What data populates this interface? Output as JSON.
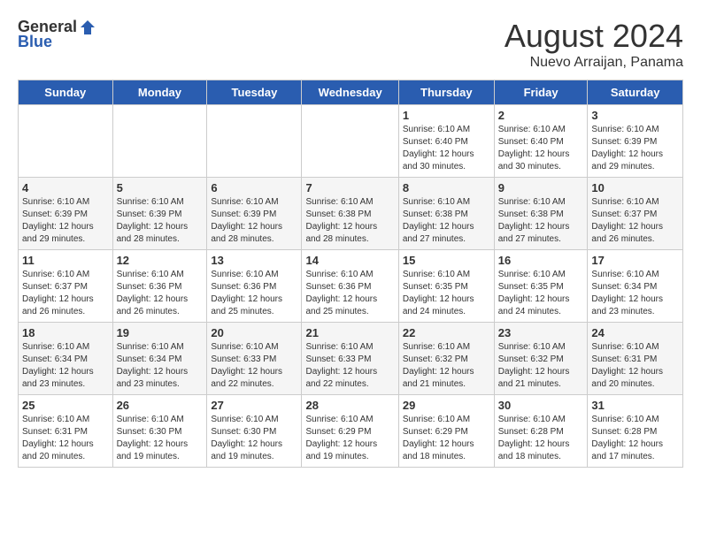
{
  "header": {
    "logo_general": "General",
    "logo_blue": "Blue",
    "title": "August 2024",
    "location": "Nuevo Arraijan, Panama"
  },
  "days_of_week": [
    "Sunday",
    "Monday",
    "Tuesday",
    "Wednesday",
    "Thursday",
    "Friday",
    "Saturday"
  ],
  "weeks": [
    [
      {
        "day": "",
        "info": ""
      },
      {
        "day": "",
        "info": ""
      },
      {
        "day": "",
        "info": ""
      },
      {
        "day": "",
        "info": ""
      },
      {
        "day": "1",
        "info": "Sunrise: 6:10 AM\nSunset: 6:40 PM\nDaylight: 12 hours\nand 30 minutes."
      },
      {
        "day": "2",
        "info": "Sunrise: 6:10 AM\nSunset: 6:40 PM\nDaylight: 12 hours\nand 30 minutes."
      },
      {
        "day": "3",
        "info": "Sunrise: 6:10 AM\nSunset: 6:39 PM\nDaylight: 12 hours\nand 29 minutes."
      }
    ],
    [
      {
        "day": "4",
        "info": "Sunrise: 6:10 AM\nSunset: 6:39 PM\nDaylight: 12 hours\nand 29 minutes."
      },
      {
        "day": "5",
        "info": "Sunrise: 6:10 AM\nSunset: 6:39 PM\nDaylight: 12 hours\nand 28 minutes."
      },
      {
        "day": "6",
        "info": "Sunrise: 6:10 AM\nSunset: 6:39 PM\nDaylight: 12 hours\nand 28 minutes."
      },
      {
        "day": "7",
        "info": "Sunrise: 6:10 AM\nSunset: 6:38 PM\nDaylight: 12 hours\nand 28 minutes."
      },
      {
        "day": "8",
        "info": "Sunrise: 6:10 AM\nSunset: 6:38 PM\nDaylight: 12 hours\nand 27 minutes."
      },
      {
        "day": "9",
        "info": "Sunrise: 6:10 AM\nSunset: 6:38 PM\nDaylight: 12 hours\nand 27 minutes."
      },
      {
        "day": "10",
        "info": "Sunrise: 6:10 AM\nSunset: 6:37 PM\nDaylight: 12 hours\nand 26 minutes."
      }
    ],
    [
      {
        "day": "11",
        "info": "Sunrise: 6:10 AM\nSunset: 6:37 PM\nDaylight: 12 hours\nand 26 minutes."
      },
      {
        "day": "12",
        "info": "Sunrise: 6:10 AM\nSunset: 6:36 PM\nDaylight: 12 hours\nand 26 minutes."
      },
      {
        "day": "13",
        "info": "Sunrise: 6:10 AM\nSunset: 6:36 PM\nDaylight: 12 hours\nand 25 minutes."
      },
      {
        "day": "14",
        "info": "Sunrise: 6:10 AM\nSunset: 6:36 PM\nDaylight: 12 hours\nand 25 minutes."
      },
      {
        "day": "15",
        "info": "Sunrise: 6:10 AM\nSunset: 6:35 PM\nDaylight: 12 hours\nand 24 minutes."
      },
      {
        "day": "16",
        "info": "Sunrise: 6:10 AM\nSunset: 6:35 PM\nDaylight: 12 hours\nand 24 minutes."
      },
      {
        "day": "17",
        "info": "Sunrise: 6:10 AM\nSunset: 6:34 PM\nDaylight: 12 hours\nand 23 minutes."
      }
    ],
    [
      {
        "day": "18",
        "info": "Sunrise: 6:10 AM\nSunset: 6:34 PM\nDaylight: 12 hours\nand 23 minutes."
      },
      {
        "day": "19",
        "info": "Sunrise: 6:10 AM\nSunset: 6:34 PM\nDaylight: 12 hours\nand 23 minutes."
      },
      {
        "day": "20",
        "info": "Sunrise: 6:10 AM\nSunset: 6:33 PM\nDaylight: 12 hours\nand 22 minutes."
      },
      {
        "day": "21",
        "info": "Sunrise: 6:10 AM\nSunset: 6:33 PM\nDaylight: 12 hours\nand 22 minutes."
      },
      {
        "day": "22",
        "info": "Sunrise: 6:10 AM\nSunset: 6:32 PM\nDaylight: 12 hours\nand 21 minutes."
      },
      {
        "day": "23",
        "info": "Sunrise: 6:10 AM\nSunset: 6:32 PM\nDaylight: 12 hours\nand 21 minutes."
      },
      {
        "day": "24",
        "info": "Sunrise: 6:10 AM\nSunset: 6:31 PM\nDaylight: 12 hours\nand 20 minutes."
      }
    ],
    [
      {
        "day": "25",
        "info": "Sunrise: 6:10 AM\nSunset: 6:31 PM\nDaylight: 12 hours\nand 20 minutes."
      },
      {
        "day": "26",
        "info": "Sunrise: 6:10 AM\nSunset: 6:30 PM\nDaylight: 12 hours\nand 19 minutes."
      },
      {
        "day": "27",
        "info": "Sunrise: 6:10 AM\nSunset: 6:30 PM\nDaylight: 12 hours\nand 19 minutes."
      },
      {
        "day": "28",
        "info": "Sunrise: 6:10 AM\nSunset: 6:29 PM\nDaylight: 12 hours\nand 19 minutes."
      },
      {
        "day": "29",
        "info": "Sunrise: 6:10 AM\nSunset: 6:29 PM\nDaylight: 12 hours\nand 18 minutes."
      },
      {
        "day": "30",
        "info": "Sunrise: 6:10 AM\nSunset: 6:28 PM\nDaylight: 12 hours\nand 18 minutes."
      },
      {
        "day": "31",
        "info": "Sunrise: 6:10 AM\nSunset: 6:28 PM\nDaylight: 12 hours\nand 17 minutes."
      }
    ]
  ]
}
